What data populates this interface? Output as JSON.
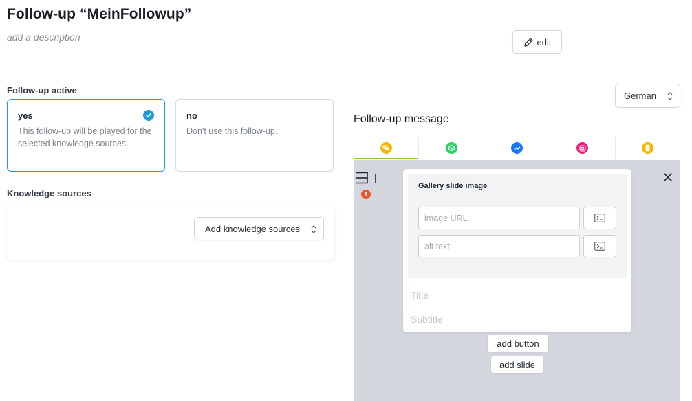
{
  "header": {
    "title": "Follow-up “MeinFollowup”",
    "description_placeholder": "add a description",
    "edit_label": "edit"
  },
  "followup_active": {
    "label": "Follow-up active",
    "options": [
      {
        "title": "yes",
        "description": "This follow-up will be played for the selected knowledge sources.",
        "selected": true
      },
      {
        "title": "no",
        "description": "Don't use this follow-up.",
        "selected": false
      }
    ]
  },
  "knowledge_sources": {
    "label": "Knowledge sources",
    "add_button_label": "Add knowledge sources"
  },
  "language": {
    "selected": "German"
  },
  "message": {
    "title": "Follow-up message",
    "channels": [
      {
        "name": "webchat",
        "icon": "chat-bubbles-icon",
        "color": "#f5b800",
        "active": true
      },
      {
        "name": "whatsapp",
        "icon": "whatsapp-icon",
        "color": "#25d366",
        "active": false
      },
      {
        "name": "messenger",
        "icon": "messenger-icon",
        "color": "#1877f2",
        "active": false
      },
      {
        "name": "instagram",
        "icon": "instagram-icon",
        "color": "#e91e7a",
        "active": false
      },
      {
        "name": "app",
        "icon": "mobile-phone-icon",
        "color": "#f5b800",
        "active": false
      }
    ],
    "gallery": {
      "image_panel_label": "Gallery slide image",
      "image_url_placeholder": "image URL",
      "alt_text_placeholder": "alt text",
      "title_placeholder": "Title",
      "subtitle_placeholder": "Subtitle",
      "add_button_label": "add button",
      "add_slide_label": "add slide"
    }
  },
  "colors": {
    "accent": "#1e9bd7",
    "active_tab_underline": "#8bc34a",
    "error": "#e8552e",
    "preview_background": "#d3d6dc"
  }
}
